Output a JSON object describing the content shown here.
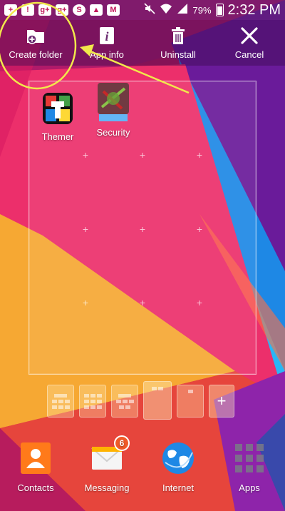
{
  "status_bar": {
    "notification_icons": [
      "plus-icon",
      "warning-icon",
      "google-plus-icon",
      "google-plus-icon",
      "sync-icon",
      "image-icon",
      "mail-icon"
    ],
    "battery_percent": "79%",
    "time": "2:32 PM"
  },
  "action_bar": {
    "items": [
      {
        "label": "Create folder",
        "icon": "create-folder-icon"
      },
      {
        "label": "App info",
        "icon": "info-icon"
      },
      {
        "label": "Uninstall",
        "icon": "trash-icon"
      },
      {
        "label": "Cancel",
        "icon": "close-icon"
      }
    ]
  },
  "home_panel": {
    "apps": [
      {
        "label": "Themer",
        "icon": "themer-icon"
      },
      {
        "label": "Security",
        "icon": "security-icon"
      }
    ]
  },
  "page_thumbnails": {
    "count": 5,
    "active_index": 3,
    "add_label": "+"
  },
  "dock": {
    "items": [
      {
        "label": "Contacts",
        "icon": "contacts-icon"
      },
      {
        "label": "Messaging",
        "icon": "messaging-icon",
        "badge": "6"
      },
      {
        "label": "Internet",
        "icon": "globe-icon"
      },
      {
        "label": "Apps",
        "icon": "apps-grid-icon"
      }
    ]
  },
  "colors": {
    "wallpaper_pink": "#e8286e",
    "wallpaper_orange": "#f7a53a",
    "wallpaper_purple": "#6a1b9a",
    "annotation": "#f2e84b"
  }
}
